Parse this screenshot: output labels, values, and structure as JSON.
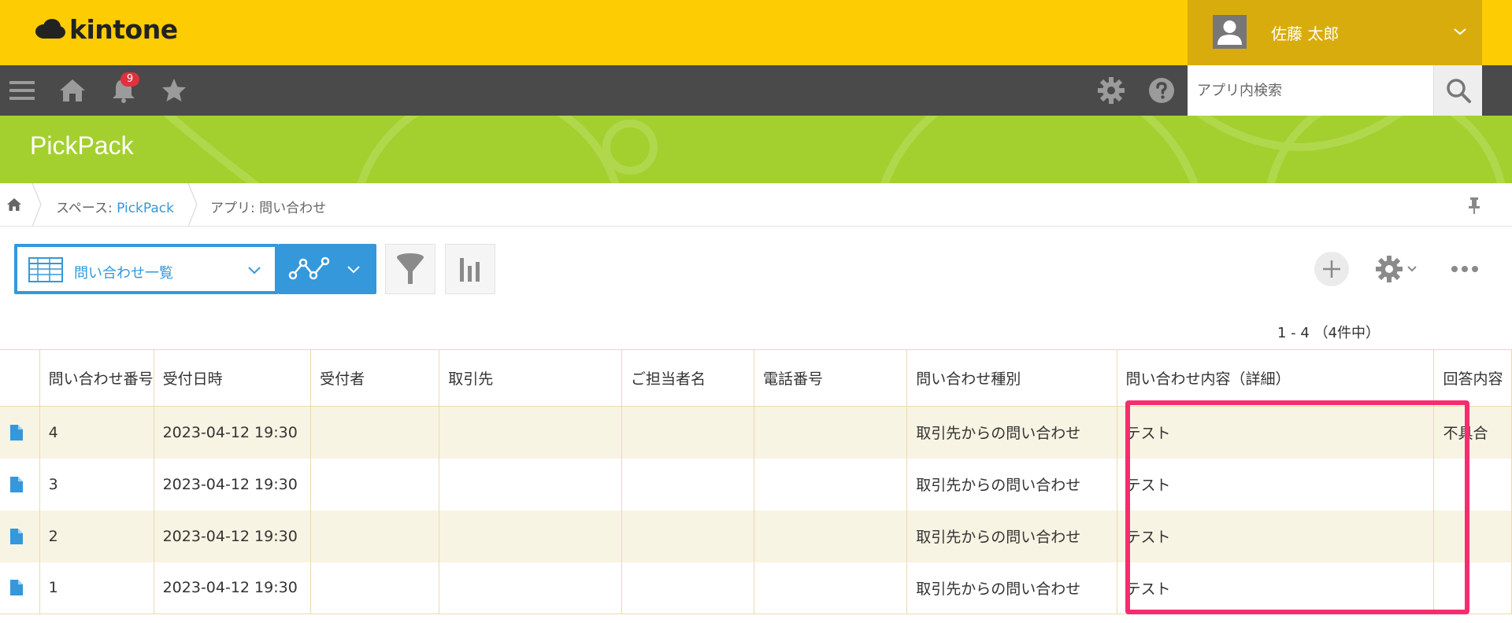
{
  "header": {
    "logo_text": "kintone",
    "user_name": "佐藤 太郎",
    "accent_color": "#fdcc02"
  },
  "nav": {
    "notification_count": "9",
    "search_placeholder": "アプリ内検索"
  },
  "app": {
    "title": "PickPack"
  },
  "breadcrumb": {
    "space_prefix": "スペース: ",
    "space_name": "PickPack",
    "app_label": "アプリ: 問い合わせ"
  },
  "toolbar": {
    "view_name": "問い合わせ一覧"
  },
  "pager": {
    "text": "1 - 4 （4件中）"
  },
  "table": {
    "columns": [
      "",
      "問い合わせ番号",
      "受付日時",
      "受付者",
      "取引先",
      "ご担当者名",
      "電話番号",
      "問い合わせ種別",
      "問い合わせ内容（詳細）",
      "回答内容"
    ],
    "rows": [
      {
        "id": "4",
        "date": "2023-04-12 19:30",
        "receiver": "",
        "client": "",
        "contact": "",
        "phone": "",
        "type": "取引先からの問い合わせ",
        "detail": "テスト",
        "answer": "不具合"
      },
      {
        "id": "3",
        "date": "2023-04-12 19:30",
        "receiver": "",
        "client": "",
        "contact": "",
        "phone": "",
        "type": "取引先からの問い合わせ",
        "detail": "テスト",
        "answer": ""
      },
      {
        "id": "2",
        "date": "2023-04-12 19:30",
        "receiver": "",
        "client": "",
        "contact": "",
        "phone": "",
        "type": "取引先からの問い合わせ",
        "detail": "テスト",
        "answer": ""
      },
      {
        "id": "1",
        "date": "2023-04-12 19:30",
        "receiver": "",
        "client": "",
        "contact": "",
        "phone": "",
        "type": "取引先からの問い合わせ",
        "detail": "テスト",
        "answer": ""
      }
    ]
  },
  "highlight_color": "#f52d6e"
}
